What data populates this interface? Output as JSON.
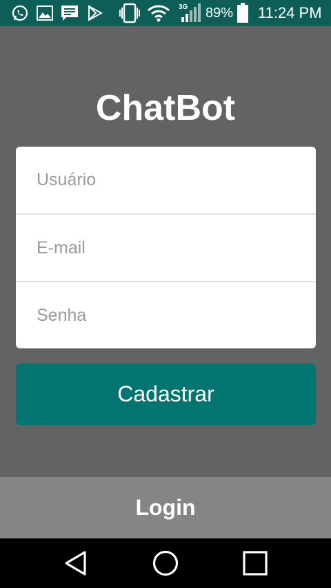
{
  "status_bar": {
    "battery_percent": "89%",
    "time": "11:24 PM",
    "network_type": "3G",
    "icons": [
      "whatsapp-icon",
      "gallery-icon",
      "message-icon",
      "play-store-icon",
      "vibrate-icon",
      "wifi-icon",
      "signal-icon",
      "battery-icon"
    ]
  },
  "app": {
    "title": "ChatBot"
  },
  "form": {
    "username_placeholder": "Usuário",
    "email_placeholder": "E-mail",
    "password_placeholder": "Senha",
    "submit_label": "Cadastrar"
  },
  "footer": {
    "login_label": "Login"
  },
  "nav_bar": {
    "buttons": [
      "back-icon",
      "home-icon",
      "recents-icon"
    ]
  },
  "colors": {
    "status_bar": "#0d5e57",
    "background": "#636363",
    "accent": "#037570",
    "footer": "#858585"
  }
}
